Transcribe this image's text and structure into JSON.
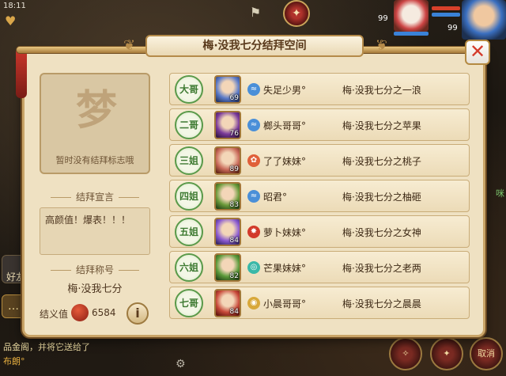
{
  "status": {
    "time": "18:11"
  },
  "hud": {
    "left_level_a": "99",
    "left_level_b": "99",
    "friends_label": "好友",
    "cancel_label": "取消"
  },
  "dialog": {
    "title": "梅·没我七分结拜空间",
    "close_glyph": "✕"
  },
  "emblem": {
    "glyph": "梦",
    "empty_text": "暂时没有结拜标志哦"
  },
  "declaration": {
    "label": "结拜宣言",
    "text": "高颜值！爆表！！！"
  },
  "bond_title": {
    "label": "结拜称号",
    "value": "梅·没我七分"
  },
  "loyalty": {
    "label": "结义值",
    "value": "6584",
    "info_glyph": "i"
  },
  "members": [
    {
      "rank": "大哥",
      "level": "69",
      "name": "失足少男°",
      "title": "梅·没我七分之一浪",
      "element": "wind",
      "element_color": "#4a8fd8",
      "portrait_color": "#5a7ac8"
    },
    {
      "rank": "二哥",
      "level": "76",
      "name": "榔头哥哥°",
      "title": "梅·没我七分之苹果",
      "element": "wind",
      "element_color": "#4a8fd8",
      "portrait_color": "#7a3a9a"
    },
    {
      "rank": "三姐",
      "level": "89",
      "name": "了了妹妹°",
      "title": "梅·没我七分之桃子",
      "element": "fire",
      "element_color": "#e0603a",
      "portrait_color": "#c96a5a"
    },
    {
      "rank": "四姐",
      "level": "83",
      "name": "昭君°",
      "title": "梅·没我七分之柚砸",
      "element": "wind",
      "element_color": "#4a8fd8",
      "portrait_color": "#6a9a3a"
    },
    {
      "rank": "五姐",
      "level": "84",
      "name": "萝卜妹妹°",
      "title": "梅·没我七分之女神",
      "element": "fire",
      "element_color": "#d23a2a",
      "portrait_color": "#8a5ad0"
    },
    {
      "rank": "六姐",
      "level": "82",
      "name": "芒果妹妹°",
      "title": "梅·没我七分之老两",
      "element": "water",
      "element_color": "#3ab8a8",
      "portrait_color": "#5a9a3a"
    },
    {
      "rank": "七哥",
      "level": "84",
      "name": "小晨哥哥°",
      "title": "梅·没我七分之晨晨",
      "element": "earth",
      "element_color": "#d8a83a",
      "portrait_color": "#c84a3a"
    }
  ],
  "chat": [
    {
      "text": "品金阁，并将它送给了",
      "color": "#e8d8a0"
    },
    {
      "text": "布朗°",
      "color": "#e8b040"
    }
  ]
}
